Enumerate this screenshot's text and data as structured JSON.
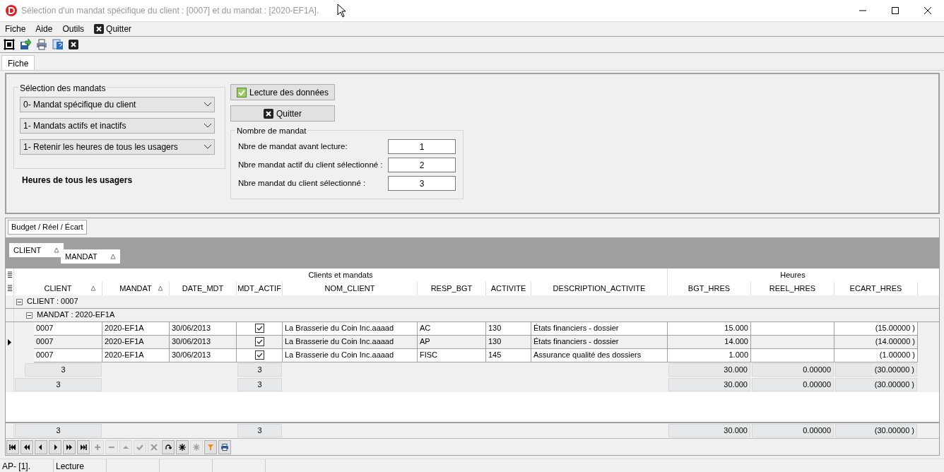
{
  "window": {
    "title": "Sélection d'un mandat spécifique du client : [0007] et du mandat : [2020-EF1A]."
  },
  "menu": [
    {
      "label": "Fiche",
      "has_icon": false
    },
    {
      "label": "Aide",
      "has_icon": false
    },
    {
      "label": "Outils",
      "has_icon": false
    },
    {
      "label": "Quitter",
      "has_icon": true
    }
  ],
  "tabs": [
    {
      "label": "Fiche",
      "selected": true
    }
  ],
  "selection": {
    "legend": "Sélection des mandats",
    "dropdowns": [
      {
        "value": "0- Mandat spécifique du client"
      },
      {
        "value": "1- Mandats actifs et inactifs"
      },
      {
        "value": "1- Retenir les heures de tous les usagers"
      }
    ],
    "note": "Heures de tous les usagers"
  },
  "buttons": [
    {
      "label": "Lecture des données"
    },
    {
      "label": "Quitter"
    }
  ],
  "counts": {
    "legend": "Nombre de mandat",
    "rows": [
      {
        "label": "Nbre de mandat avant lecture:",
        "value": "1"
      },
      {
        "label": "Nbre mandat actif du client sélectionné :",
        "value": "2"
      },
      {
        "label": "Nbre mandat du client sélectionné :",
        "value": "3"
      }
    ]
  },
  "subtabs": [
    {
      "label": "Budget / Réel / Écart",
      "selected": true
    }
  ],
  "group_by": [
    {
      "label": "CLIENT"
    },
    {
      "label": "MANDAT"
    }
  ],
  "grid": {
    "bands": [
      {
        "label": "Clients et mandats"
      },
      {
        "label": "Heures"
      }
    ],
    "columns": [
      {
        "label": "CLIENT",
        "sorted": true
      },
      {
        "label": "MANDAT",
        "sorted": true
      },
      {
        "label": "DATE_MDT",
        "sorted": false
      },
      {
        "label": "MDT_ACTIF",
        "sorted": false
      },
      {
        "label": "NOM_CLIENT",
        "sorted": false
      },
      {
        "label": "RESP_BGT",
        "sorted": false
      },
      {
        "label": "ACTIVITE",
        "sorted": false
      },
      {
        "label": "DESCRIPTION_ACTIVITE",
        "sorted": false
      },
      {
        "label": "BGT_HRES",
        "sorted": false
      },
      {
        "label": "REEL_HRES",
        "sorted": false
      },
      {
        "label": "ECART_HRES",
        "sorted": false
      }
    ],
    "groups": [
      {
        "label": "CLIENT : 0007",
        "expanded": true,
        "children": [
          {
            "label": "MANDAT : 2020-EF1A",
            "expanded": true,
            "rows": [
              {
                "current": false,
                "client": "0007",
                "mandat": "2020-EF1A",
                "date_mdt": "30/06/2013",
                "mdt_actif": true,
                "nom_client": "La Brasserie du Coin Inc.aaaad",
                "resp_bgt": "AC",
                "activite": "130",
                "description": "États financiers - dossier",
                "bgt_hres": "15.000",
                "ecart_hres": "(15.00000 )"
              },
              {
                "current": true,
                "client": "0007",
                "mandat": "2020-EF1A",
                "date_mdt": "30/06/2013",
                "mdt_actif": true,
                "nom_client": "La Brasserie du Coin Inc.aaaad",
                "resp_bgt": "AP",
                "activite": "130",
                "description": "États financiers - dossier",
                "bgt_hres": "14.000",
                "ecart_hres": "(14.00000 )"
              },
              {
                "current": false,
                "client": "0007",
                "mandat": "2020-EF1A",
                "date_mdt": "30/06/2013",
                "mdt_actif": true,
                "nom_client": "La Brasserie du Coin Inc.aaaad",
                "resp_bgt": "FISC",
                "activite": "145",
                "description": "Assurance qualité des dossiers",
                "bgt_hres": "1.000",
                "ecart_hres": "(1.00000 )"
              }
            ],
            "summary": {
              "client": "3",
              "mdt_actif": "3",
              "bgt_hres": "30.000",
              "reel_hres": "0.00000",
              "ecart_hres": "(30.00000 )"
            }
          }
        ],
        "summary": {
          "client": "3",
          "mdt_actif": "3",
          "bgt_hres": "30.000",
          "reel_hres": "0.00000",
          "ecart_hres": "(30.00000 )"
        }
      }
    ],
    "footer": {
      "client": "3",
      "mdt_actif": "3",
      "bgt_hres": "30.000",
      "reel_hres": "0.00000",
      "ecart_hres": "(30.00000 )"
    }
  },
  "navigator": [
    {
      "disabled": false
    },
    {
      "disabled": false
    },
    {
      "disabled": false
    },
    {
      "disabled": false
    },
    {
      "disabled": false
    },
    {
      "disabled": false
    },
    {
      "disabled": true
    },
    {
      "disabled": true
    },
    {
      "disabled": true
    },
    {
      "disabled": true
    },
    {
      "disabled": true
    },
    {
      "disabled": false
    },
    {
      "disabled": false
    },
    {
      "disabled": true
    },
    {
      "disabled": false
    },
    {
      "disabled": false
    }
  ],
  "status_bar": [
    {
      "text": "AP- [1]."
    },
    {
      "text": "Lecture"
    }
  ]
}
